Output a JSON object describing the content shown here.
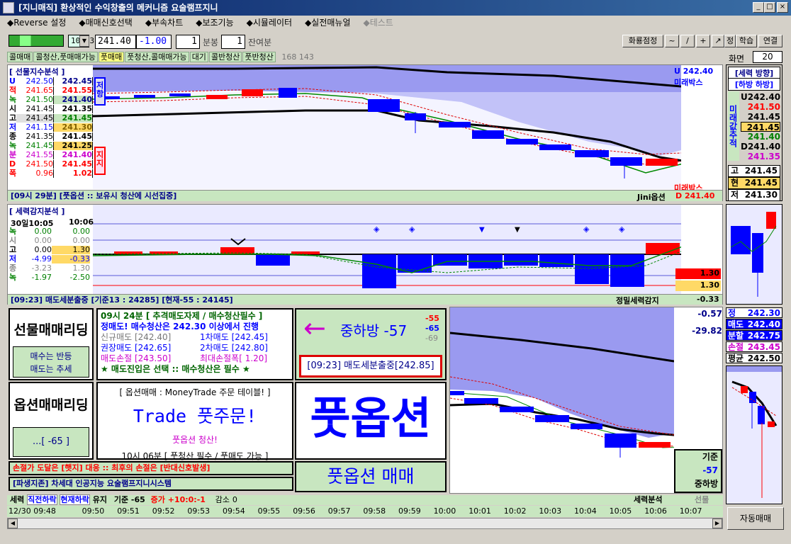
{
  "window": {
    "title": "[지니매직] 환상적인 수익창출의 메커니즘 요술램프지니"
  },
  "menu": [
    "◆Reverse 설정",
    "◆매매신호선택",
    "◆부속차트",
    "◆보조기능",
    "◆시뮬레이터",
    "◆실전매뉴얼",
    "◆테스트"
  ],
  "toolbar": {
    "code": "101L3",
    "price": "241.40",
    "change": "-1.00",
    "bong_count": "1",
    "bong_label": "분봉",
    "remain_count": "1",
    "remain_label": "잔여분",
    "right_buttons": [
      "화룡점정",
      "~",
      "/",
      "+",
      "↗",
      "정",
      "학습",
      "연결"
    ],
    "screen_label": "화면",
    "screen_value": "20"
  },
  "tags": [
    "콜매매",
    "콜청산,풋매매가능",
    "풋매매",
    "풋청산,콜매매가능",
    "대기",
    "콜반청산",
    "풋반청산"
  ],
  "tags_extra": "168 143",
  "futures_panel": {
    "title": "[ 선물지수분석 ]",
    "rows": [
      {
        "k": "U",
        "a": "242.50",
        "b": "242.45"
      },
      {
        "k": "적",
        "a": "241.65",
        "b": "241.55"
      },
      {
        "k": "녹",
        "a": "241.50",
        "b": "241.40"
      },
      {
        "k": "시",
        "a": "241.45",
        "b": "241.35"
      },
      {
        "k": "고",
        "a": "241.45",
        "b": "241.45"
      },
      {
        "k": "저",
        "a": "241.15",
        "b": "241.30"
      },
      {
        "k": "종",
        "a": "241.35",
        "b": "241.45"
      },
      {
        "k": "녹",
        "a": "241.45",
        "b": "241.25"
      },
      {
        "k": "분",
        "a": "241.55",
        "b": "241.40"
      },
      {
        "k": "D",
        "a": "241.50",
        "b": "241.45"
      },
      {
        "k": "폭",
        "a": "0.96",
        "b": "1.02"
      }
    ],
    "resist": "저항",
    "support": "지지",
    "status": "[09시 29분] [풋옵션 :: 보유시 청산에 시선집중]",
    "status_right": "Jini옵션",
    "scale_top": "U 242.40",
    "scale_top2": "미래박스",
    "scale_bot": "미래박스",
    "scale_bot2": "D 241.40"
  },
  "side_panel": {
    "dir_title": "[세력 방향]",
    "dir_value": "[하방 하방]",
    "vertical": "미래값추적",
    "vals": [
      "U242.40",
      "241.50",
      "241.45",
      "241.45",
      "241.40",
      "D241.40",
      "241.35"
    ],
    "high": {
      "k": "고",
      "v": "241.45"
    },
    "cur": {
      "k": "현",
      "v": "241.45"
    },
    "low": {
      "k": "저",
      "v": "241.30"
    }
  },
  "force_panel": {
    "title": "[ 세력감지분석 ]",
    "time1": "30일10:05",
    "time2": "10:06",
    "rows": [
      {
        "k": "녹",
        "a": "0.00",
        "b": "0.00"
      },
      {
        "k": "시",
        "a": "0.00",
        "b": "0.00"
      },
      {
        "k": "고",
        "a": "0.00",
        "b": "1.30"
      },
      {
        "k": "저",
        "a": "-4.99",
        "b": "-0.33"
      },
      {
        "k": "종",
        "a": "-3.23",
        "b": "1.30"
      },
      {
        "k": "녹",
        "a": "-1.97",
        "b": "-2.50"
      }
    ],
    "status": "[09:23] 매도세분출중 [기준13 : 24285] [현재-55 : 24145]",
    "status_right": "정밀세력감지",
    "val1": "1.30",
    "val2": "1.30",
    "val3": "-0.33"
  },
  "trading": {
    "futures_title": "선물매매리딩",
    "futures_sub1": "매수는 반등",
    "futures_sub2": "매도는 추세",
    "option_title": "옵션매매리딩",
    "option_sub": "...[ -65 ]",
    "sig_head": "09시 24분 [ 추격매도자제 / 매수청산필수 ]",
    "sig_l1": "정매도! 매수청산은 242.30 이상에서 진행",
    "sig_l2a": "신규매도 [242.40]",
    "sig_l2b": "1차매도 [242.45]",
    "sig_l3a": "권장매도 [242.65]",
    "sig_l3b": "2차매도 [242.80]",
    "sig_l4a": "매도손절 [243.50]",
    "sig_l4b": "최대손절폭[ 1.20]",
    "sig_l5": "★ 매도진입은 선택  ::  매수청산은 필수 ★",
    "dir_label": "중하방 -57",
    "dir_v1": "-55",
    "dir_v2": "-65",
    "dir_v3": "-69",
    "burst": "[09:23] 매도세분출중[242.85]",
    "opt_head": "[ 옵션매매 : MoneyTrade 주문 테이블! ]",
    "trade_txt": "Trade 풋주문!",
    "opt_l1": "풋옵션 청산!",
    "opt_l2": "10시 06분 [ 풋청산 필수 /  풋매도 가능  ]",
    "big": "풋옵션",
    "big_sub": "풋옵션 매매",
    "warn": "손절가 도달은 [햇지] 대응 :: 최후의 손절은 [반대신호발생]",
    "deriv": "[파생지존] 차세대 인공지능 요술램프지니시스템"
  },
  "lower_chart": {
    "v1": "-0.57",
    "v2": "-29.82",
    "box_l1": "기준",
    "box_l2": "-57",
    "box_l3": "중하방"
  },
  "right_lower": {
    "rows": [
      {
        "k": "정",
        "v": "242.30"
      },
      {
        "k": "매도",
        "v": "242.40"
      },
      {
        "k": "분할",
        "v": "242.75"
      },
      {
        "k": "손절",
        "v": "243.45"
      },
      {
        "k": "평균",
        "v": "242.50"
      }
    ]
  },
  "bottom_status": {
    "l1": "세력",
    "l2": "직전하락",
    "l3": "현재하락",
    "l4": "유지",
    "l5": "기준 -65",
    "l6": "증가",
    "l7": "+10:0:-1",
    "l8": "감소",
    "l9": "0",
    "r1": "세력분석",
    "r2": "선물"
  },
  "time_axis": [
    "12/30 09:48",
    "09:50",
    "09:51",
    "09:52",
    "09:53",
    "09:54",
    "09:55",
    "09:56",
    "09:57",
    "09:58",
    "09:59",
    "10:00",
    "10:01",
    "10:02",
    "10:03",
    "10:04",
    "10:05",
    "10:06",
    "10:07"
  ],
  "auto_button": "자동매매",
  "colors": {
    "blue": "#0000ff",
    "red": "#ff0000",
    "chartbg": "#e8e8ff",
    "band": "#9a9af0",
    "green": "#c8e6c0"
  }
}
